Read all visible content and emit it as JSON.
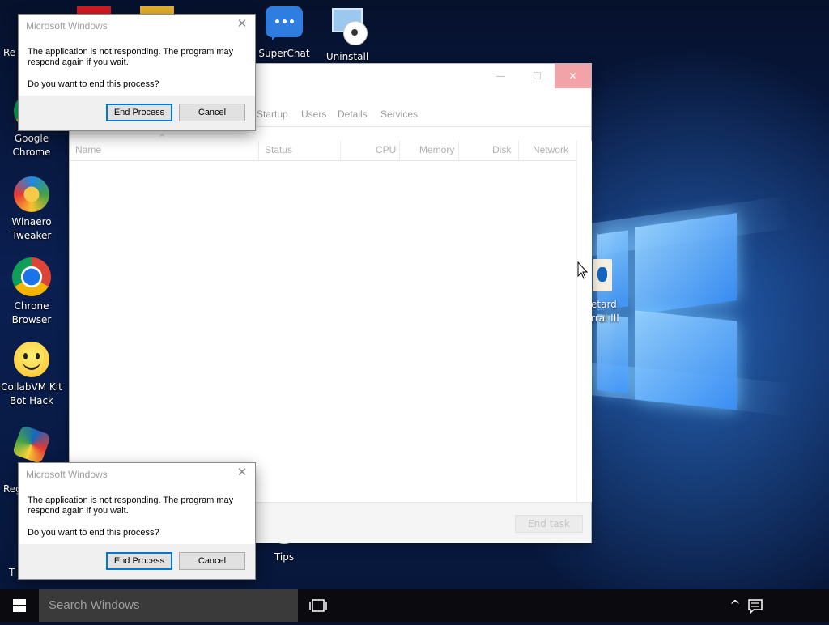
{
  "desktop": {
    "icons": [
      {
        "label": "Re"
      },
      {
        "label": "Google\nChrome"
      },
      {
        "label": "Winaero\nTweaker"
      },
      {
        "label": "Chrone\nBrowser"
      },
      {
        "label": "CollabVM Kit\nBot Hack"
      },
      {
        "label": "Reg"
      },
      {
        "label": "T"
      },
      {
        "label": "SuperChat"
      },
      {
        "label": "Uninstall"
      },
      {
        "label": "Tips"
      },
      {
        "label": "etard\nrral III"
      }
    ]
  },
  "task_manager": {
    "minimize_symbol": "—",
    "maximize_symbol": "☐",
    "close_symbol": "✕",
    "tabs": [
      "Startup",
      "Users",
      "Details",
      "Services"
    ],
    "sort_arrow": "^",
    "columns": [
      "Name",
      "Status",
      "CPU",
      "Memory",
      "Disk",
      "Network"
    ],
    "end_task_label": "End task"
  },
  "dialogs": [
    {
      "title": "Microsoft Windows",
      "close_symbol": "✕",
      "message": "The application is not responding. The program may respond again if you wait.",
      "question": "Do you want to end this process?",
      "end_process_label": "End Process",
      "cancel_label": "Cancel"
    },
    {
      "title": "Microsoft Windows",
      "close_symbol": "✕",
      "message": "The application is not responding. The program may respond again if you wait.",
      "question": "Do you want to end this process?",
      "end_process_label": "End Process",
      "cancel_label": "Cancel"
    }
  ],
  "taskbar": {
    "search_placeholder": "Search Windows",
    "tray_arrow": "^"
  },
  "colors": {
    "accent": "#0078d7",
    "taskbar": "#0b0b0f",
    "close_hover": "#f2a3a8"
  }
}
